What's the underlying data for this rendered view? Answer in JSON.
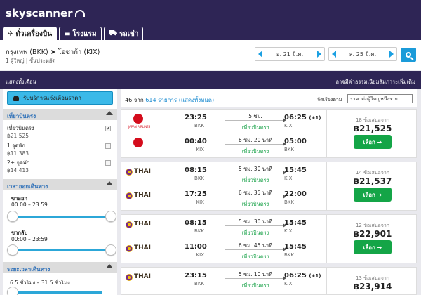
{
  "header": {
    "logo_text": "skyscanner"
  },
  "tabs": [
    {
      "label": "ตั๋วเครื่องบิน",
      "icon": "airplane-icon",
      "active": true
    },
    {
      "label": "โรงแรม",
      "icon": "bed-icon",
      "active": false
    },
    {
      "label": "รถเช่า",
      "icon": "car-icon",
      "active": false
    }
  ],
  "search": {
    "route": "กรุงเทพ (BKK) ➤ โอซาก้า (KIX)",
    "passengers": "1 ผู้ใหญ่ | ชั้นประหยัด",
    "depart_date": "อ. 21 มี.ค.",
    "return_date": "ส. 25 มี.ค."
  },
  "bar": {
    "show_all": "แสดงทั้งเดือน",
    "fees_note": "อาจมีค่าธรรมเนียมสัมภาระเพิ่มเติม"
  },
  "sidebar": {
    "alert_button": "รับบริการแจ้งเตือนราคา",
    "stops_heading": "เที่ยวบินตรง",
    "stops": [
      {
        "label": "เที่ยวบินตรง",
        "price": "฿21,525",
        "checked": true
      },
      {
        "label": "1 จุดพัก",
        "price": "฿11,383",
        "checked": false
      },
      {
        "label": "2+ จุดพัก",
        "price": "฿14,413",
        "checked": false
      }
    ],
    "times_heading": "เวลาออกเดินทาง",
    "outbound_label": "ขาออก",
    "outbound_range": "00:00 – 23:59",
    "return_label": "ขากลับ",
    "return_range": "00:00 – 23:59",
    "duration_heading": "ระยะเวลาเดินทาง",
    "duration_range": "6.5 ชั่วโมง – 31.5 ชั่วโมง"
  },
  "results_header": {
    "count_prefix": "46 จาก ",
    "count_link": "614 รายการ (แสดงทั้งหมด)",
    "sort_label": "จัดเรียงตาม",
    "sort_value": "ราคาต่อผู้ใหญ่หนึ่งราย"
  },
  "cards": [
    {
      "airline": "JAL",
      "airline_sub": "JAPAN AIRLINES",
      "deals": "18 ข้อเสนอจาก",
      "price": "฿21,525",
      "select_label": "เลือก ➔",
      "legs": [
        {
          "dep_time": "23:25",
          "dep_code": "BKK",
          "duration": "5 ชม.",
          "direct": "เที่ยวบินตรง",
          "arr_time": "06:25",
          "plus": "(+1)",
          "arr_code": "KIX"
        },
        {
          "dep_time": "00:40",
          "dep_code": "KIX",
          "duration": "6 ชม. 20 นาที",
          "direct": "เที่ยวบินตรง",
          "arr_time": "05:00",
          "plus": "",
          "arr_code": "BKK"
        }
      ]
    },
    {
      "airline": "THAI",
      "airline_sub": "",
      "deals": "14 ข้อเสนอจาก",
      "price": "฿21,537",
      "select_label": "เลือก ➔",
      "legs": [
        {
          "dep_time": "08:15",
          "dep_code": "BKK",
          "duration": "5 ชม. 30 นาที",
          "direct": "เที่ยวบินตรง",
          "arr_time": "15:45",
          "plus": "",
          "arr_code": "KIX"
        },
        {
          "dep_time": "17:25",
          "dep_code": "KIX",
          "duration": "6 ชม. 35 นาที",
          "direct": "เที่ยวบินตรง",
          "arr_time": "22:00",
          "plus": "",
          "arr_code": "BKK"
        }
      ]
    },
    {
      "airline": "THAI",
      "airline_sub": "",
      "deals": "12 ข้อเสนอจาก",
      "price": "฿22,901",
      "select_label": "เลือก ➔",
      "legs": [
        {
          "dep_time": "08:15",
          "dep_code": "BKK",
          "duration": "5 ชม. 30 นาที",
          "direct": "เที่ยวบินตรง",
          "arr_time": "15:45",
          "plus": "",
          "arr_code": "KIX"
        },
        {
          "dep_time": "11:00",
          "dep_code": "KIX",
          "duration": "6 ชม. 45 นาที",
          "direct": "เที่ยวบินตรง",
          "arr_time": "15:45",
          "plus": "",
          "arr_code": "BKK"
        }
      ]
    },
    {
      "airline": "THAI",
      "airline_sub": "",
      "deals": "13 ข้อเสนอจาก",
      "price": "฿23,914",
      "select_label": "เลือก ➔",
      "legs": [
        {
          "dep_time": "23:15",
          "dep_code": "BKK",
          "duration": "5 ชม. 10 นาที",
          "direct": "เที่ยวบินตรง",
          "arr_time": "06:25",
          "plus": "(+1)",
          "arr_code": "KIX"
        }
      ]
    }
  ]
}
